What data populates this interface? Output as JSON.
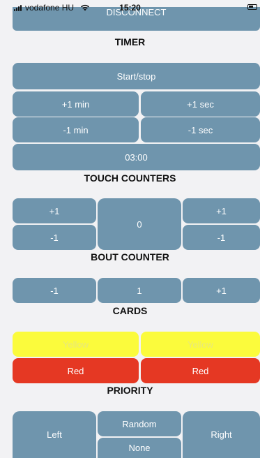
{
  "status_bar": {
    "carrier": "vodafone HU",
    "time": "15:20"
  },
  "top_button": {
    "label": "DISCONNECT"
  },
  "timer": {
    "heading": "TIMER",
    "start_stop": "Start/stop",
    "plus_min": "+1 min",
    "plus_sec": "+1 sec",
    "minus_min": "-1 min",
    "minus_sec": "-1 sec",
    "display": "03:00"
  },
  "touch_counters": {
    "heading": "TOUCH COUNTERS",
    "left_plus": "+1",
    "left_minus": "-1",
    "score": "0",
    "right_plus": "+1",
    "right_minus": "-1"
  },
  "bout_counter": {
    "heading": "BOUT COUNTER",
    "minus": "-1",
    "value": "1",
    "plus": "+1"
  },
  "cards": {
    "heading": "CARDS",
    "left_yellow": "Yellow",
    "right_yellow": "Yellow",
    "left_red": "Red",
    "right_red": "Red"
  },
  "priority": {
    "heading": "PRIORITY",
    "left": "Left",
    "random": "Random",
    "none": "None",
    "right": "Right"
  },
  "colors": {
    "button": "#6f95ad",
    "yellow": "#fbfb3c",
    "red": "#e53823",
    "background": "#f2f2f4"
  }
}
